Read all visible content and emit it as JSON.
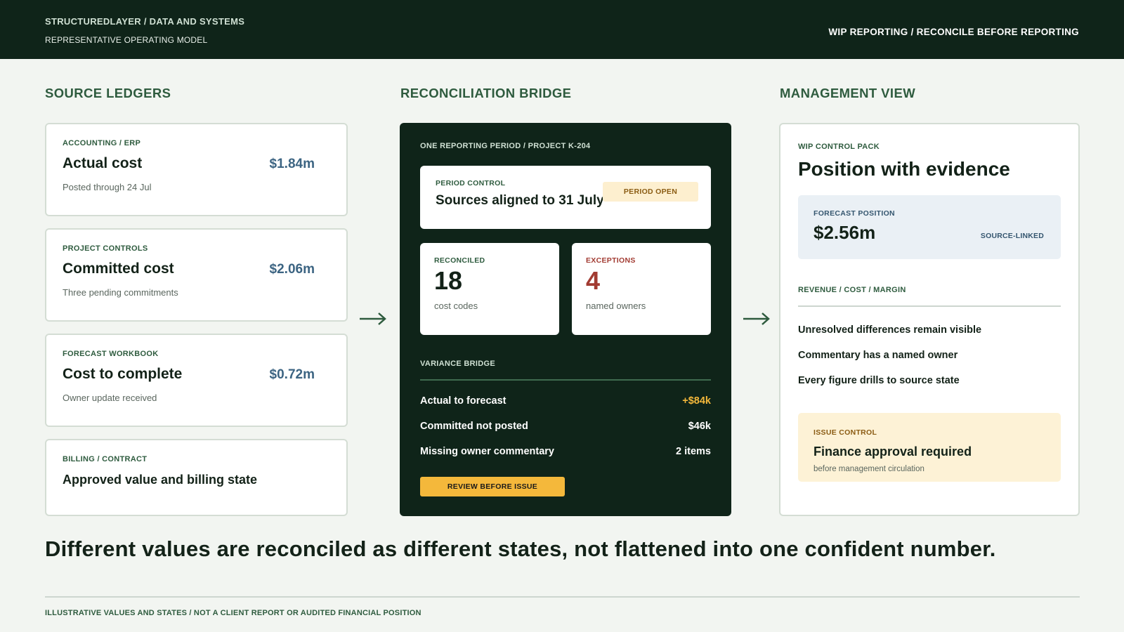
{
  "header": {
    "brand": "STRUCTUREDLAYER / DATA AND SYSTEMS",
    "subtitle": "REPRESENTATIVE OPERATING MODEL",
    "context": "WIP REPORTING / RECONCILE BEFORE REPORTING"
  },
  "sections": {
    "source": "SOURCE LEDGERS",
    "bridge": "RECONCILIATION BRIDGE",
    "management": "MANAGEMENT VIEW"
  },
  "ledgers": [
    {
      "category": "ACCOUNTING / ERP",
      "name": "Actual cost",
      "amount": "$1.84m",
      "note": "Posted through 24 Jul"
    },
    {
      "category": "PROJECT CONTROLS",
      "name": "Committed cost",
      "amount": "$2.06m",
      "note": "Three pending commitments"
    },
    {
      "category": "FORECAST WORKBOOK",
      "name": "Cost to complete",
      "amount": "$0.72m",
      "note": "Owner update received"
    },
    {
      "category": "BILLING / CONTRACT",
      "name": "Approved value and billing state"
    }
  ],
  "bridge": {
    "period_label": "ONE REPORTING PERIOD / PROJECT K-204",
    "period_control": {
      "label": "PERIOD CONTROL",
      "title": "Sources aligned to 31 July",
      "status": "PERIOD OPEN"
    },
    "reconciled": {
      "label": "RECONCILED",
      "value": "18",
      "caption": "cost codes"
    },
    "exceptions": {
      "label": "EXCEPTIONS",
      "value": "4",
      "caption": "named owners"
    },
    "variance_label": "VARIANCE BRIDGE",
    "variance_rows": [
      {
        "label": "Actual to forecast",
        "value": "+$84k"
      },
      {
        "label": "Committed not posted",
        "value": "$46k"
      },
      {
        "label": "Missing owner commentary",
        "value": "2 items"
      }
    ],
    "review_button": "REVIEW BEFORE ISSUE"
  },
  "management": {
    "pack_label": "WIP CONTROL PACK",
    "headline": "Position with evidence",
    "forecast": {
      "label": "FORECAST POSITION",
      "value": "$2.56m",
      "tag": "SOURCE-LINKED"
    },
    "rcm_label": "REVENUE / COST / MARGIN",
    "points": [
      "Unresolved differences remain visible",
      "Commentary has a named owner",
      "Every figure drills to source state"
    ],
    "issue": {
      "label": "ISSUE CONTROL",
      "title": "Finance approval required",
      "note": "before management circulation"
    }
  },
  "tagline": "Different values are reconciled as different states, not flattened into one confident number.",
  "footer": "ILLUSTRATIVE VALUES AND STATES / NOT A CLIENT REPORT OR AUDITED FINANCIAL POSITION",
  "colors": {
    "header_bg": "#0f2419",
    "accent_green": "#2e5b3e",
    "amount_blue": "#3c6482",
    "exception_red": "#a23b32",
    "warning_amber": "#f4b83b",
    "variance_positive": "#f4b83b"
  },
  "icons": [
    "arrow-right-icon",
    "arrow-right-icon"
  ]
}
